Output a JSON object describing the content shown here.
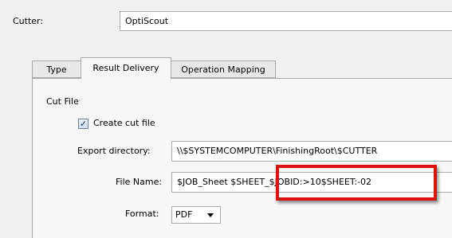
{
  "cutter": {
    "label": "Cutter:",
    "value": "OptiScout"
  },
  "tabs": [
    {
      "label": "Type"
    },
    {
      "label": "Result Delivery"
    },
    {
      "label": "Operation Mapping"
    }
  ],
  "cut_file": {
    "section_title": "Cut File",
    "create_cut_file": {
      "label": "Create cut file",
      "checked": true
    },
    "export_directory": {
      "label": "Export directory:",
      "value": "\\\\$SYSTEMCOMPUTER\\FinishingRoot\\$CUTTER"
    },
    "file_name": {
      "label": "File Name:",
      "value": "$JOB_Sheet $SHEET_$JOBID:>10$SHEET:-02"
    },
    "format": {
      "label": "Format:",
      "value": "PDF"
    }
  },
  "colors": {
    "highlight": "#e01010",
    "tab_border": "#a9a9a9"
  }
}
